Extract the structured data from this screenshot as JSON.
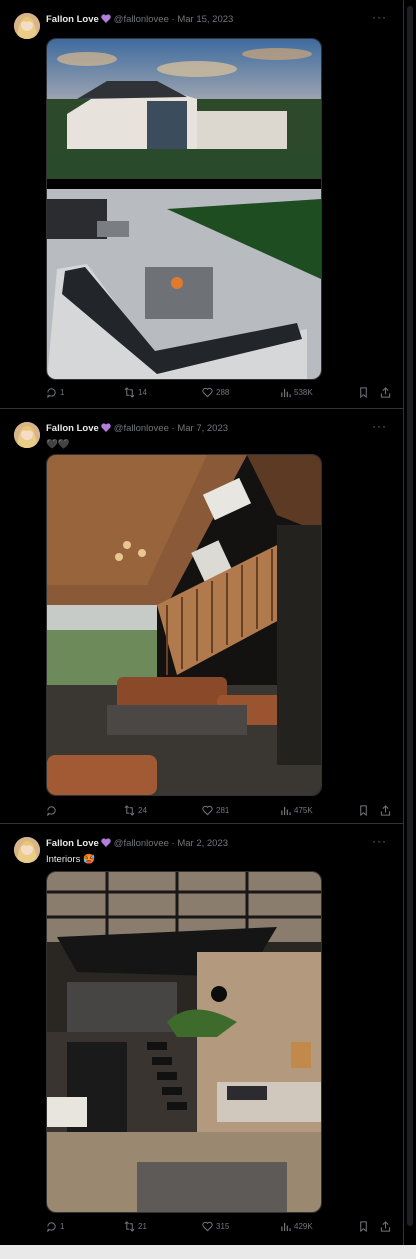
{
  "tweets": [
    {
      "name": "Fallon Love",
      "handle": "@fallonlovee",
      "separator": "·",
      "date": "Mar 15, 2023",
      "text": "",
      "stats": {
        "replies": "1",
        "retweets": "14",
        "likes": "288",
        "views": "538K"
      }
    },
    {
      "name": "Fallon Love",
      "handle": "@fallonlovee",
      "separator": "·",
      "date": "Mar 7, 2023",
      "text": "🖤🖤",
      "stats": {
        "replies": "",
        "retweets": "24",
        "likes": "281",
        "views": "475K"
      }
    },
    {
      "name": "Fallon Love",
      "handle": "@fallonlovee",
      "separator": "·",
      "date": "Mar 2, 2023",
      "text": "Interiors 🥵",
      "stats": {
        "replies": "1",
        "retweets": "21",
        "likes": "315",
        "views": "429K"
      }
    }
  ],
  "more_glyph": "···",
  "colors": {
    "background": "#000000",
    "text": "#e7e9ea",
    "muted": "#71767b",
    "border": "#2f3336",
    "verified": "#b57edc"
  }
}
